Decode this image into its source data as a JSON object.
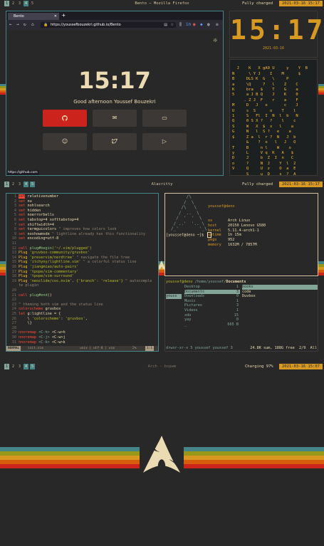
{
  "colors": {
    "bg": "#282828",
    "accent": "#d79921",
    "blue": "#458588",
    "aqua": "#83a598",
    "red": "#cc241d"
  },
  "bars": [
    {
      "workspaces": [
        "1",
        "2",
        "3",
        "4",
        "5"
      ],
      "active": "1",
      "title": "Bento — Mozilla Firefox",
      "battery": "Fully charged",
      "datetime": "2021-03-16 15:17"
    },
    {
      "workspaces": [
        "1",
        "2",
        "3",
        "4",
        "5"
      ],
      "active": "1",
      "title": "Alacritty",
      "battery": "Fully charged",
      "datetime": "2021-03-16 15:17"
    },
    {
      "workspaces": [
        "1",
        "2",
        "3",
        "4",
        "5"
      ],
      "active": "1",
      "title": "Arch - bspwm",
      "battery": "Charging 97%",
      "datetime": "2021-03-16 15:07"
    }
  ],
  "firefox": {
    "tab_title": "Bento",
    "url": "https://youssefbouzekri.github.io/Bento",
    "status_url": "https://github.com",
    "time": "15:17",
    "greeting": "Good afternoon Youssef Bouzekri",
    "buttons": [
      {
        "icon": "github-icon",
        "glyph": "⌥"
      },
      {
        "icon": "mail-icon",
        "glyph": "✉"
      },
      {
        "icon": "monitor-icon",
        "glyph": "▭"
      },
      {
        "icon": "reddit-icon",
        "glyph": "☺"
      },
      {
        "icon": "twitter-icon",
        "glyph": "🐦"
      },
      {
        "icon": "youtube-icon",
        "glyph": "▷"
      }
    ]
  },
  "clock": {
    "time": "15:17",
    "date": "2021-03-16"
  },
  "vim": {
    "lines": [
      {
        "n": "1",
        "t": [
          [
            "kw",
            "set"
          ],
          [
            "id",
            " relativenumber"
          ]
        ]
      },
      {
        "n": "2",
        "t": [
          [
            "kw",
            "set"
          ],
          [
            "id",
            " nu"
          ]
        ]
      },
      {
        "n": "3",
        "t": [
          [
            "kw",
            "set"
          ],
          [
            "id",
            " nohlsearch"
          ]
        ]
      },
      {
        "n": "4",
        "t": [
          [
            "kw",
            "set"
          ],
          [
            "id",
            " hidden"
          ]
        ]
      },
      {
        "n": "5",
        "t": [
          [
            "kw",
            "set"
          ],
          [
            "id",
            " noerrorbells"
          ]
        ]
      },
      {
        "n": "6",
        "t": [
          [
            "kw",
            "set"
          ],
          [
            "id",
            " tabstop=4 softtabstop=4"
          ]
        ]
      },
      {
        "n": "7",
        "t": [
          [
            "kw",
            "set"
          ],
          [
            "id",
            " shiftwidth=4"
          ]
        ]
      },
      {
        "n": "8",
        "t": [
          [
            "kw",
            "set"
          ],
          [
            "id",
            " termguicolors "
          ],
          [
            "com",
            "\" improves how colors look"
          ]
        ]
      },
      {
        "n": "9",
        "t": [
          [
            "kw",
            "set"
          ],
          [
            "id",
            " noshowmode "
          ],
          [
            "com",
            "\" lightline already has this functionality"
          ]
        ]
      },
      {
        "n": "10",
        "t": [
          [
            "kw",
            "set"
          ],
          [
            "id",
            " encoding=utf-8"
          ]
        ]
      },
      {
        "n": "11",
        "t": []
      },
      {
        "n": "12",
        "t": [
          [
            "kw",
            "call"
          ],
          [
            "fn",
            " plug#begin"
          ],
          [
            "str",
            "('~/.vim/plugged')"
          ]
        ]
      },
      {
        "n": "13",
        "t": [
          [
            "yl",
            "Plug "
          ],
          [
            "str",
            "'gruvbox-community/gruvbox'"
          ]
        ]
      },
      {
        "n": "14",
        "t": [
          [
            "yl",
            "Plug "
          ],
          [
            "str",
            "'preservim/nerdtree'"
          ],
          [
            "com",
            " \" navigate the file tree"
          ]
        ]
      },
      {
        "n": "15",
        "t": [
          [
            "yl",
            "Plug "
          ],
          [
            "str",
            "'itchyny/lightline.vim'"
          ],
          [
            "com",
            " \" a colorful status line"
          ]
        ]
      },
      {
        "n": "16",
        "t": [
          [
            "yl",
            "Plug "
          ],
          [
            "str",
            "'jiangmiao/auto-pairs'"
          ]
        ]
      },
      {
        "n": "17",
        "t": [
          [
            "yl",
            "Plug "
          ],
          [
            "str",
            "'tpope/vim-commentary'"
          ]
        ]
      },
      {
        "n": "18",
        "t": [
          [
            "yl",
            "Plug "
          ],
          [
            "str",
            "'tpope/vim-surround'"
          ]
        ]
      },
      {
        "n": "19",
        "t": [
          [
            "yl",
            "Plug "
          ],
          [
            "str",
            "'neoclide/coc.nvim', {'branch': 'release'}"
          ],
          [
            "com",
            " \" autocomple"
          ]
        ]
      },
      {
        "n": "",
        "t": [
          [
            "com",
            "te plugin"
          ]
        ]
      },
      {
        "n": "20",
        "t": []
      },
      {
        "n": "21",
        "t": [
          [
            "kw",
            "call"
          ],
          [
            "fn",
            " plug#end"
          ],
          [
            "id",
            "()"
          ]
        ]
      },
      {
        "n": "22",
        "t": []
      },
      {
        "n": "23",
        "t": [
          [
            "com",
            "\" theming both vim and the status line"
          ]
        ]
      },
      {
        "n": "24",
        "t": [
          [
            "kw",
            "colorscheme"
          ],
          [
            "id",
            " gruvbox"
          ]
        ]
      },
      {
        "n": "25",
        "t": [
          [
            "kw",
            "let"
          ],
          [
            "id",
            " g:lightline = {"
          ]
        ]
      },
      {
        "n": "26",
        "t": [
          [
            "id",
            "    \\ "
          ],
          [
            "str",
            "'colorscheme'"
          ],
          [
            "id",
            ": "
          ],
          [
            "str",
            "'gruvbox'"
          ],
          [
            "id",
            ","
          ]
        ]
      },
      {
        "n": "27",
        "t": [
          [
            "id",
            "    \\}"
          ]
        ]
      },
      {
        "n": "28",
        "t": []
      },
      {
        "n": "29",
        "t": [
          [
            "kw",
            "nnoremap"
          ],
          [
            "pp",
            " <C-h>"
          ],
          [
            "id",
            " <C-w>h"
          ]
        ]
      },
      {
        "n": "30",
        "t": [
          [
            "kw",
            "nnoremap"
          ],
          [
            "pp",
            " <C-j>"
          ],
          [
            "id",
            " <C-w>j"
          ]
        ]
      },
      {
        "n": "31",
        "t": [
          [
            "kw",
            "nnoremap"
          ],
          [
            "pp",
            " <C-k>"
          ],
          [
            "id",
            " <C-w>k"
          ]
        ]
      }
    ],
    "status": {
      "mode": "NORMAL",
      "file": "init.vim",
      "format": "unix | utf-8 | vim",
      "percent": "2%",
      "pos": "1:1"
    }
  },
  "neofetch": {
    "header": "youssef@deno",
    "prompt": "[youssef@deno ~]$",
    "info": [
      {
        "k": "os",
        "v": "Arch Linux"
      },
      {
        "k": "host",
        "v": "20150 Lenovo G580"
      },
      {
        "k": "kernel",
        "v": "5.11.4-arch1-1"
      },
      {
        "k": "uptime",
        "v": "1h 15m"
      },
      {
        "k": "pkgs",
        "v": "952"
      },
      {
        "k": "memory",
        "v": "1632M / 7857M"
      }
    ]
  },
  "ranger": {
    "path_user": "youssef@deno",
    "path_dir": "/home/youssef/",
    "path_cur": "Documents",
    "col0": [
      "youss"
    ],
    "col1": [
      {
        "name": "Desktop",
        "count": "1"
      },
      {
        "name": "Documents",
        "count": "3"
      },
      {
        "name": "Downloads",
        "count": "0"
      },
      {
        "name": "Music",
        "count": "1"
      },
      {
        "name": "Pictures",
        "count": "3"
      },
      {
        "name": "Videos",
        "count": "1"
      },
      {
        "name": "xdo",
        "count": "15"
      },
      {
        "name": "yay",
        "count": "0"
      },
      {
        "name": "_",
        "count": "665 B"
      }
    ],
    "col2": [
      "books",
      "code",
      "Duvbox"
    ],
    "footer": "drwxr-xr-x 5 youssef youssef 3",
    "footer_right": "24.8K sum, 188G free  2/9  All"
  }
}
